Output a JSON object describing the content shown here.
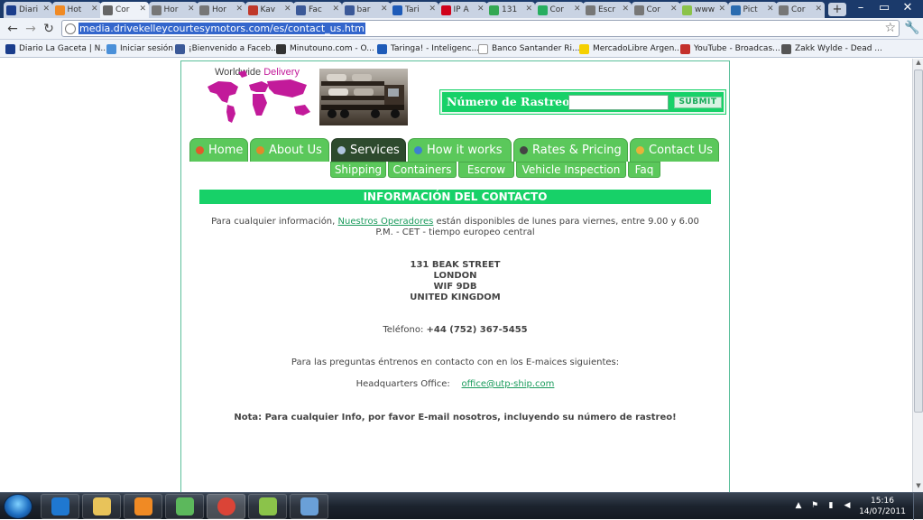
{
  "browser": {
    "tabs": [
      {
        "label": "Diari",
        "fav": "#1a3d8c"
      },
      {
        "label": "Hot",
        "fav": "#f08a24"
      },
      {
        "label": "Cor",
        "fav": "#666666",
        "active": true
      },
      {
        "label": "Hor",
        "fav": "#777777"
      },
      {
        "label": "Hor",
        "fav": "#777777"
      },
      {
        "label": "Kav",
        "fav": "#c0392b"
      },
      {
        "label": "Fac",
        "fav": "#3b5998"
      },
      {
        "label": "bar",
        "fav": "#3b5998"
      },
      {
        "label": "Tari",
        "fav": "#1e5bb8"
      },
      {
        "label": "IP A",
        "fav": "#d0021b"
      },
      {
        "label": "131",
        "fav": "#34a853"
      },
      {
        "label": "Cor",
        "fav": "#27ae60"
      },
      {
        "label": "Escr",
        "fav": "#777777"
      },
      {
        "label": "Cor",
        "fav": "#777777"
      },
      {
        "label": "www",
        "fav": "#8bc34a"
      },
      {
        "label": "Pict",
        "fav": "#2b6cb0"
      },
      {
        "label": "Cor",
        "fav": "#777777"
      }
    ],
    "new_tab_label": "+",
    "window_controls": {
      "minimize": "–",
      "maximize": "▭",
      "close": "✕"
    },
    "url": "media.drivekelleycourtesymotors.com/es/contact_us.htm",
    "bookmarks": [
      {
        "label": "Diario La Gaceta | N...",
        "icon": "#1a3d8c"
      },
      {
        "label": "Iniciar sesión",
        "icon": "#4a90d9"
      },
      {
        "label": "¡Bienvenido a Faceb...",
        "icon": "#3b5998"
      },
      {
        "label": "Minutouno.com - O...",
        "icon": "#333333"
      },
      {
        "label": "Taringa! - Inteligenc...",
        "icon": "#1e5bb8"
      },
      {
        "label": "Banco Santander Ri...",
        "icon": "#ffffff"
      },
      {
        "label": "MercadoLibre Argen...",
        "icon": "#f5d000"
      },
      {
        "label": "YouTube - Broadcas...",
        "icon": "#c4302b"
      },
      {
        "label": "Zakk Wylde - Dead ...",
        "icon": "#555555"
      }
    ]
  },
  "site": {
    "logo_text_plain": "Worldwide ",
    "logo_text_accent": "Delivery",
    "tracking": {
      "label": "Número de Rastreo",
      "submit": "SUBMIT",
      "value": ""
    },
    "nav": [
      {
        "label": "Home",
        "icon": "#e05a2a"
      },
      {
        "label": "About Us",
        "icon": "#e08a2a"
      },
      {
        "label": "Services",
        "icon": "#b0c4de",
        "active": true
      },
      {
        "label": "How it works",
        "icon": "#3d7fd0"
      },
      {
        "label": "Rates & Pricing",
        "icon": "#444444"
      },
      {
        "label": "Contact Us",
        "icon": "#e8b23a"
      }
    ],
    "subnav": [
      "Shipping",
      "Containers",
      "Escrow",
      "Vehicle Inspection",
      "Faq"
    ],
    "section_title": "INFORMACIÓN DEL CONTACTO",
    "intro_before": "Para cualquier información, ",
    "intro_link": "Nuestros Operadores",
    "intro_after": " están disponibles de lunes para viernes, entre 9.00 y 6.00",
    "intro_line2": "P.M. - CET - tiempo europeo central",
    "address": [
      "131 BEAK STREET",
      "LONDON",
      "WIF 9DB",
      "UNITED KINGDOM"
    ],
    "phone_label": "Teléfono: ",
    "phone_value": "+44 (752) 367-5455",
    "questions_text": "Para las preguntas éntrenos en contacto con en los E-maices siguientes:",
    "hq_label": "Headquarters Office:",
    "hq_email": "office@utp-ship.com",
    "note": "Nota: Para cualquier Info, por favor E-mail nosotros, incluyendo su número de rastreo!"
  },
  "taskbar": {
    "apps": [
      {
        "name": "ie",
        "color": "#1f78d1"
      },
      {
        "name": "explorer",
        "color": "#e8c35a"
      },
      {
        "name": "media-player",
        "color": "#f08a24"
      },
      {
        "name": "messenger",
        "color": "#5cb85c"
      },
      {
        "name": "chrome",
        "color": "#db4437",
        "active": true
      },
      {
        "name": "app-a",
        "color": "#8bc34a"
      },
      {
        "name": "paint",
        "color": "#6aa0d8"
      }
    ],
    "time": "15:16",
    "date": "14/07/2011"
  }
}
